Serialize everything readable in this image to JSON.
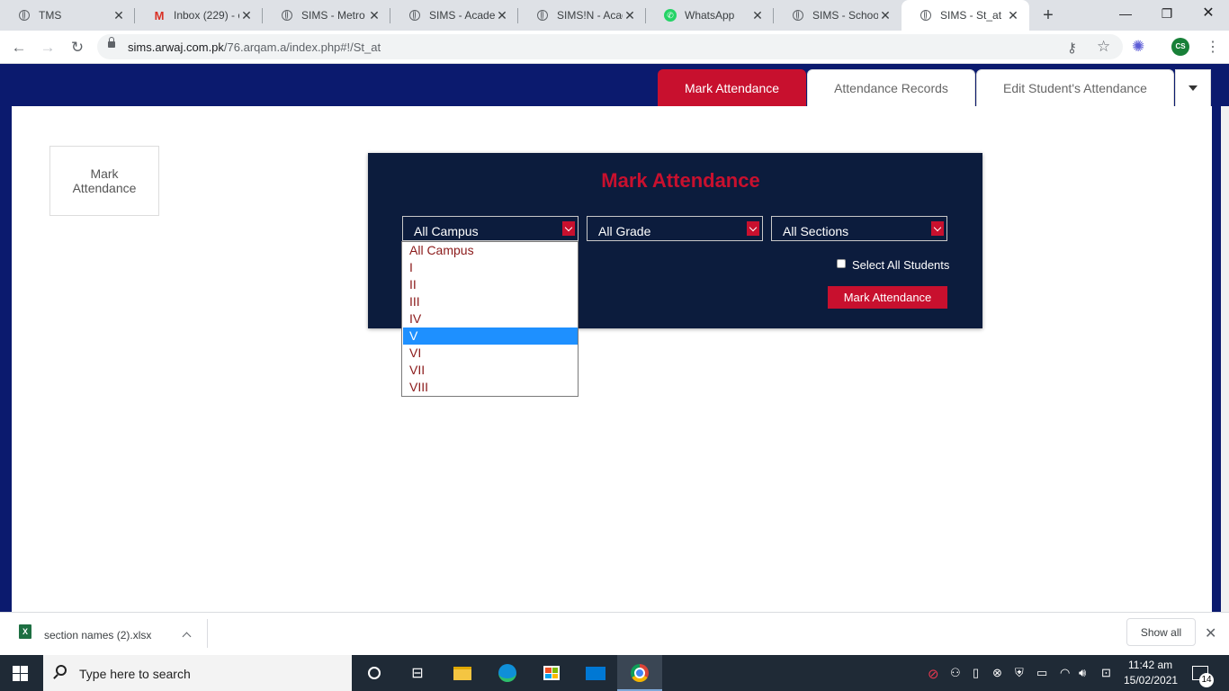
{
  "browser": {
    "tabs": [
      {
        "title": "TMS",
        "icon": "globe-icon"
      },
      {
        "title": "Inbox (229) - c",
        "icon": "gmail-icon"
      },
      {
        "title": "SIMS - Metro I",
        "icon": "globe-icon"
      },
      {
        "title": "SIMS - Acaden",
        "icon": "globe-icon"
      },
      {
        "title": "SIMS!N - Acad",
        "icon": "globe-icon"
      },
      {
        "title": "WhatsApp",
        "icon": "whatsapp-icon"
      },
      {
        "title": "SIMS - School",
        "icon": "globe-icon"
      },
      {
        "title": "SIMS - St_at",
        "icon": "globe-icon",
        "active": true
      }
    ],
    "url_host": "sims.arwaj.com.pk",
    "url_path": "/76.arqam.a/index.php#!/St_at",
    "profile_initials": "CS"
  },
  "page": {
    "tabs": {
      "mark": "Mark Attendance",
      "records": "Attendance Records",
      "edit": "Edit Student's Attendance"
    },
    "side_button": "Mark Attendance",
    "panel": {
      "title": "Mark Attendance",
      "campus_selected": "All Campus",
      "grade_selected": "All Grade",
      "sections_selected": "All Sections",
      "select_all_label": "Select All Students",
      "mark_button": "Mark Attendance",
      "campus_options": [
        "All Campus",
        "I",
        "II",
        "III",
        "IV",
        "V",
        "VI",
        "VII",
        "VIII"
      ],
      "highlighted_option": "V"
    }
  },
  "downloads": {
    "file": "section names (2).xlsx",
    "show_all": "Show all"
  },
  "taskbar": {
    "search_placeholder": "Type here to search",
    "time": "11:42 am",
    "date": "15/02/2021",
    "notifications": "14"
  },
  "colors": {
    "header_blue": "#0b1a6e",
    "panel_navy": "#0c1c3d",
    "accent_red": "#c8102e",
    "highlight_blue": "#1e90ff"
  }
}
